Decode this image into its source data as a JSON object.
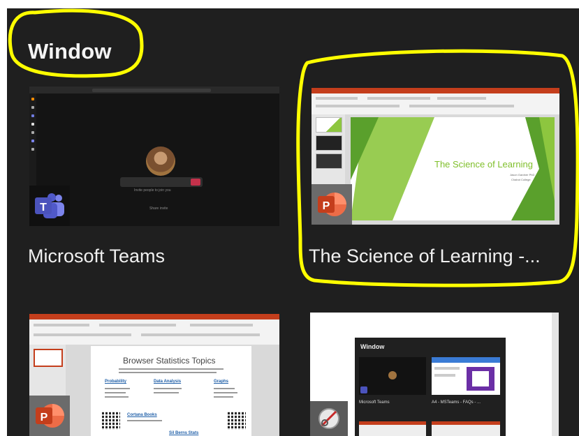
{
  "section": {
    "title": "Window"
  },
  "windows": [
    {
      "caption": "Microsoft Teams",
      "app_icon": "teams-icon",
      "call_hint": "Invite people to join you",
      "call_link": "Share invite"
    },
    {
      "caption": "The Science of Learning -...",
      "app_icon": "powerpoint-icon",
      "slide_title": "The Science of Learning",
      "slide_subtitle_1": "Jason Gardner PhD",
      "slide_subtitle_2": "Chabot College"
    },
    {
      "caption": "",
      "app_icon": "powerpoint-icon",
      "doc_title": "Browser Statistics Topics",
      "headings": [
        "Probability",
        "Data Analysis",
        "Graphs"
      ],
      "qr_heading": "Cortana Books",
      "qr_subheading": "Sil Berns Stats"
    },
    {
      "caption": "",
      "app_icon": "snipping-tool-icon",
      "nested_title": "Window",
      "nested_captions": [
        "Microsoft Teams",
        "A4 - MSTeams - FAQs - ..."
      ]
    }
  ],
  "colors": {
    "highlight": "#ffff00",
    "panel": "#1f1f1f",
    "teams": "#4b53bc",
    "powerpoint": "#c43e1c"
  }
}
